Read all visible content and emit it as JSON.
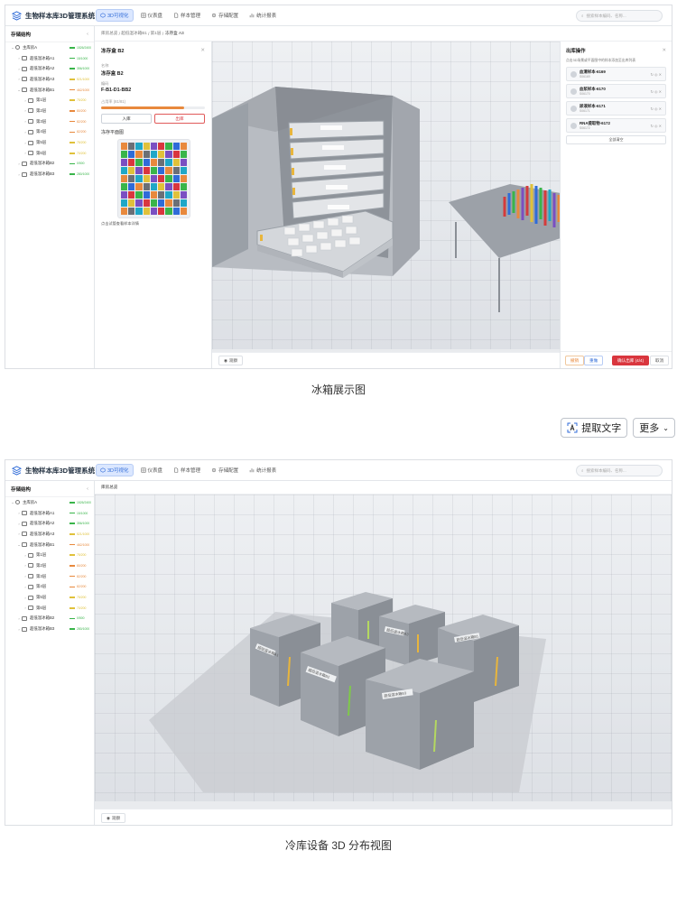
{
  "app": {
    "title": "生物样本库3D管理系统",
    "nav": [
      {
        "label": "3D可视化",
        "active": true
      },
      {
        "label": "仪表盘"
      },
      {
        "label": "样本管理"
      },
      {
        "label": "存储配置"
      },
      {
        "label": "统计报表"
      }
    ],
    "search_placeholder": "搜索样本编码、名称..."
  },
  "sidebar": {
    "title": "存储结构",
    "collapse": "‹",
    "items": [
      {
        "label": "主库房A",
        "level": 0,
        "open": true,
        "status": "1526/2400",
        "color": "#39b54a"
      },
      {
        "label": "超低温冰箱A1",
        "level": 1,
        "status": "15/1000",
        "color": "#39b54a"
      },
      {
        "label": "超低温冰箱A2",
        "level": 1,
        "status": "356/1000",
        "color": "#39b54a"
      },
      {
        "label": "超低温冰箱A3",
        "level": 1,
        "status": "521/1000",
        "color": "#e0c13a"
      },
      {
        "label": "超低温冰箱B1",
        "level": 1,
        "open": true,
        "status": "462/1000",
        "color": "#e8893d"
      },
      {
        "label": "第1层",
        "level": 2,
        "status": "75/200",
        "color": "#e0c13a"
      },
      {
        "label": "第2层",
        "level": 2,
        "status": "80/200",
        "color": "#e8893d"
      },
      {
        "label": "第3层",
        "level": 2,
        "status": "82/200",
        "color": "#e8893d"
      },
      {
        "label": "第4层",
        "level": 2,
        "status": "82/200",
        "color": "#e8893d"
      },
      {
        "label": "第5层",
        "level": 2,
        "status": "75/200",
        "color": "#e0c13a"
      },
      {
        "label": "第6层",
        "level": 2,
        "status": "70/200",
        "color": "#e0c13a"
      },
      {
        "label": "超低温冰箱B2",
        "level": 1,
        "status": "0/500",
        "color": "#39b54a"
      },
      {
        "label": "超低温冰箱B3",
        "level": 1,
        "status": "280/1000",
        "color": "#39b54a"
      }
    ]
  },
  "view1": {
    "breadcrumb": [
      "库房总览",
      "超低温冰箱B1",
      "第1层"
    ],
    "breadcrumb_current": "冻存盒 A3",
    "detail": {
      "title": "冻存盒 B2",
      "name_label": "名称",
      "name": "冻存盒 B2",
      "code_label": "编码",
      "code": "F-B1-D1-BB2",
      "usage_label": "占用率 (81/81)",
      "usage_fraction": 0.8,
      "in_label": "入库",
      "out_label": "出库",
      "grid_title": "冻存平面图",
      "grid_hint": "点击试管查看样本详情"
    },
    "outbound": {
      "title": "出库操作",
      "desc": "点击3D场景或平面图中的样本添加至出库列表",
      "items": [
        {
          "name": "血清样本-6169",
          "code": "S06169"
        },
        {
          "name": "血浆样本-6170",
          "code": "S06170"
        },
        {
          "name": "尿液样本-6171",
          "code": "S06171"
        },
        {
          "name": "RNA提取物-6172",
          "code": "S06172"
        }
      ],
      "item_actions": "↻ ◎ ✕",
      "clear_label": "全部清空",
      "btn_a": "撤销",
      "btn_b": "重做",
      "confirm": "确认出库 (4/4)",
      "cancel": "取消"
    },
    "view_button": "观察",
    "caption": "冰箱展示图"
  },
  "tools": {
    "extract": "提取文字",
    "more": "更多"
  },
  "view2": {
    "breadcrumb_current": "库房总览",
    "fridge_labels": [
      "超低温冰箱A1",
      "超低温冰箱A2",
      "超低温冰箱A3",
      "超低温冰箱B1",
      "超低温冰箱B2",
      "超低温冰箱B3"
    ],
    "view_button": "观察",
    "caption": "冷库设备 3D 分布视图"
  }
}
